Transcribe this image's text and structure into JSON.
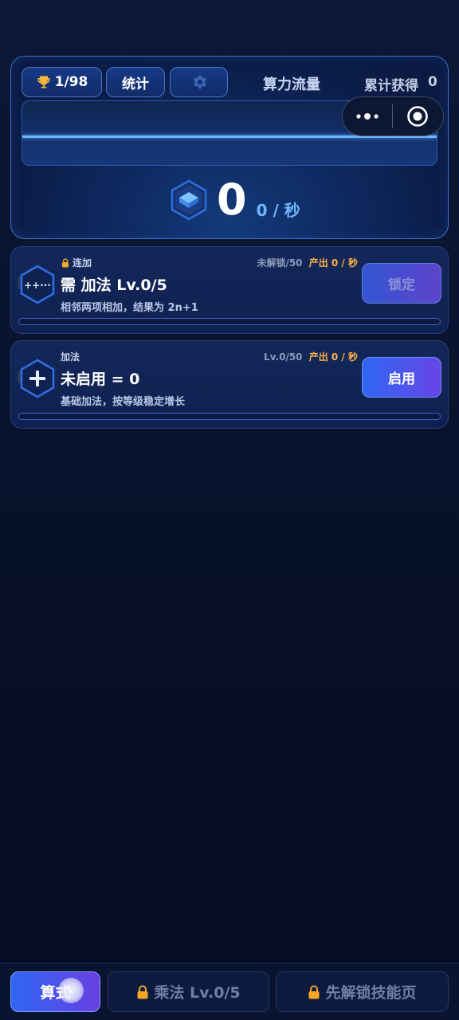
{
  "header": {
    "trophy_icon": "trophy-icon",
    "trophy_count": "1/98",
    "stats_label": "统计",
    "settings_icon": "gear-icon",
    "flow_title": "算力流量",
    "total_label": "累计获得",
    "total_value": "0"
  },
  "capsule": {
    "more_icon": "more-dots-icon",
    "close_icon": "target-circle-icon"
  },
  "rate": {
    "icon": "cube-icon",
    "value": "0",
    "unit": "0 / 秒"
  },
  "skills": [
    {
      "tag": "连加",
      "locked": true,
      "level": "未解锁/50",
      "output": "产出  0 / 秒",
      "title": "需 加法 Lv.0/5",
      "desc": "相邻两项相加，结果为 2n+1",
      "button": "锁定",
      "icon": "plus-plus-icon",
      "progress": 0
    },
    {
      "tag": "加法",
      "locked": false,
      "level": "Lv.0/50",
      "output": "产出  0 / 秒",
      "title": "未启用 = 0",
      "desc": "基础加法，按等级稳定增长",
      "button": "启用",
      "icon": "plus-icon",
      "progress": 0
    }
  ],
  "bottom_nav": {
    "tabs": [
      {
        "label": "算式",
        "active": true
      },
      {
        "label": "乘法 Lv.0/5",
        "locked": true
      },
      {
        "label": "先解锁技能页",
        "locked": true
      }
    ]
  },
  "colors": {
    "accent_blue": "#2f67f2",
    "accent_purple": "#6a3fe2",
    "output_orange": "#ffb347",
    "rate_unit_blue": "#6fb8ff"
  }
}
